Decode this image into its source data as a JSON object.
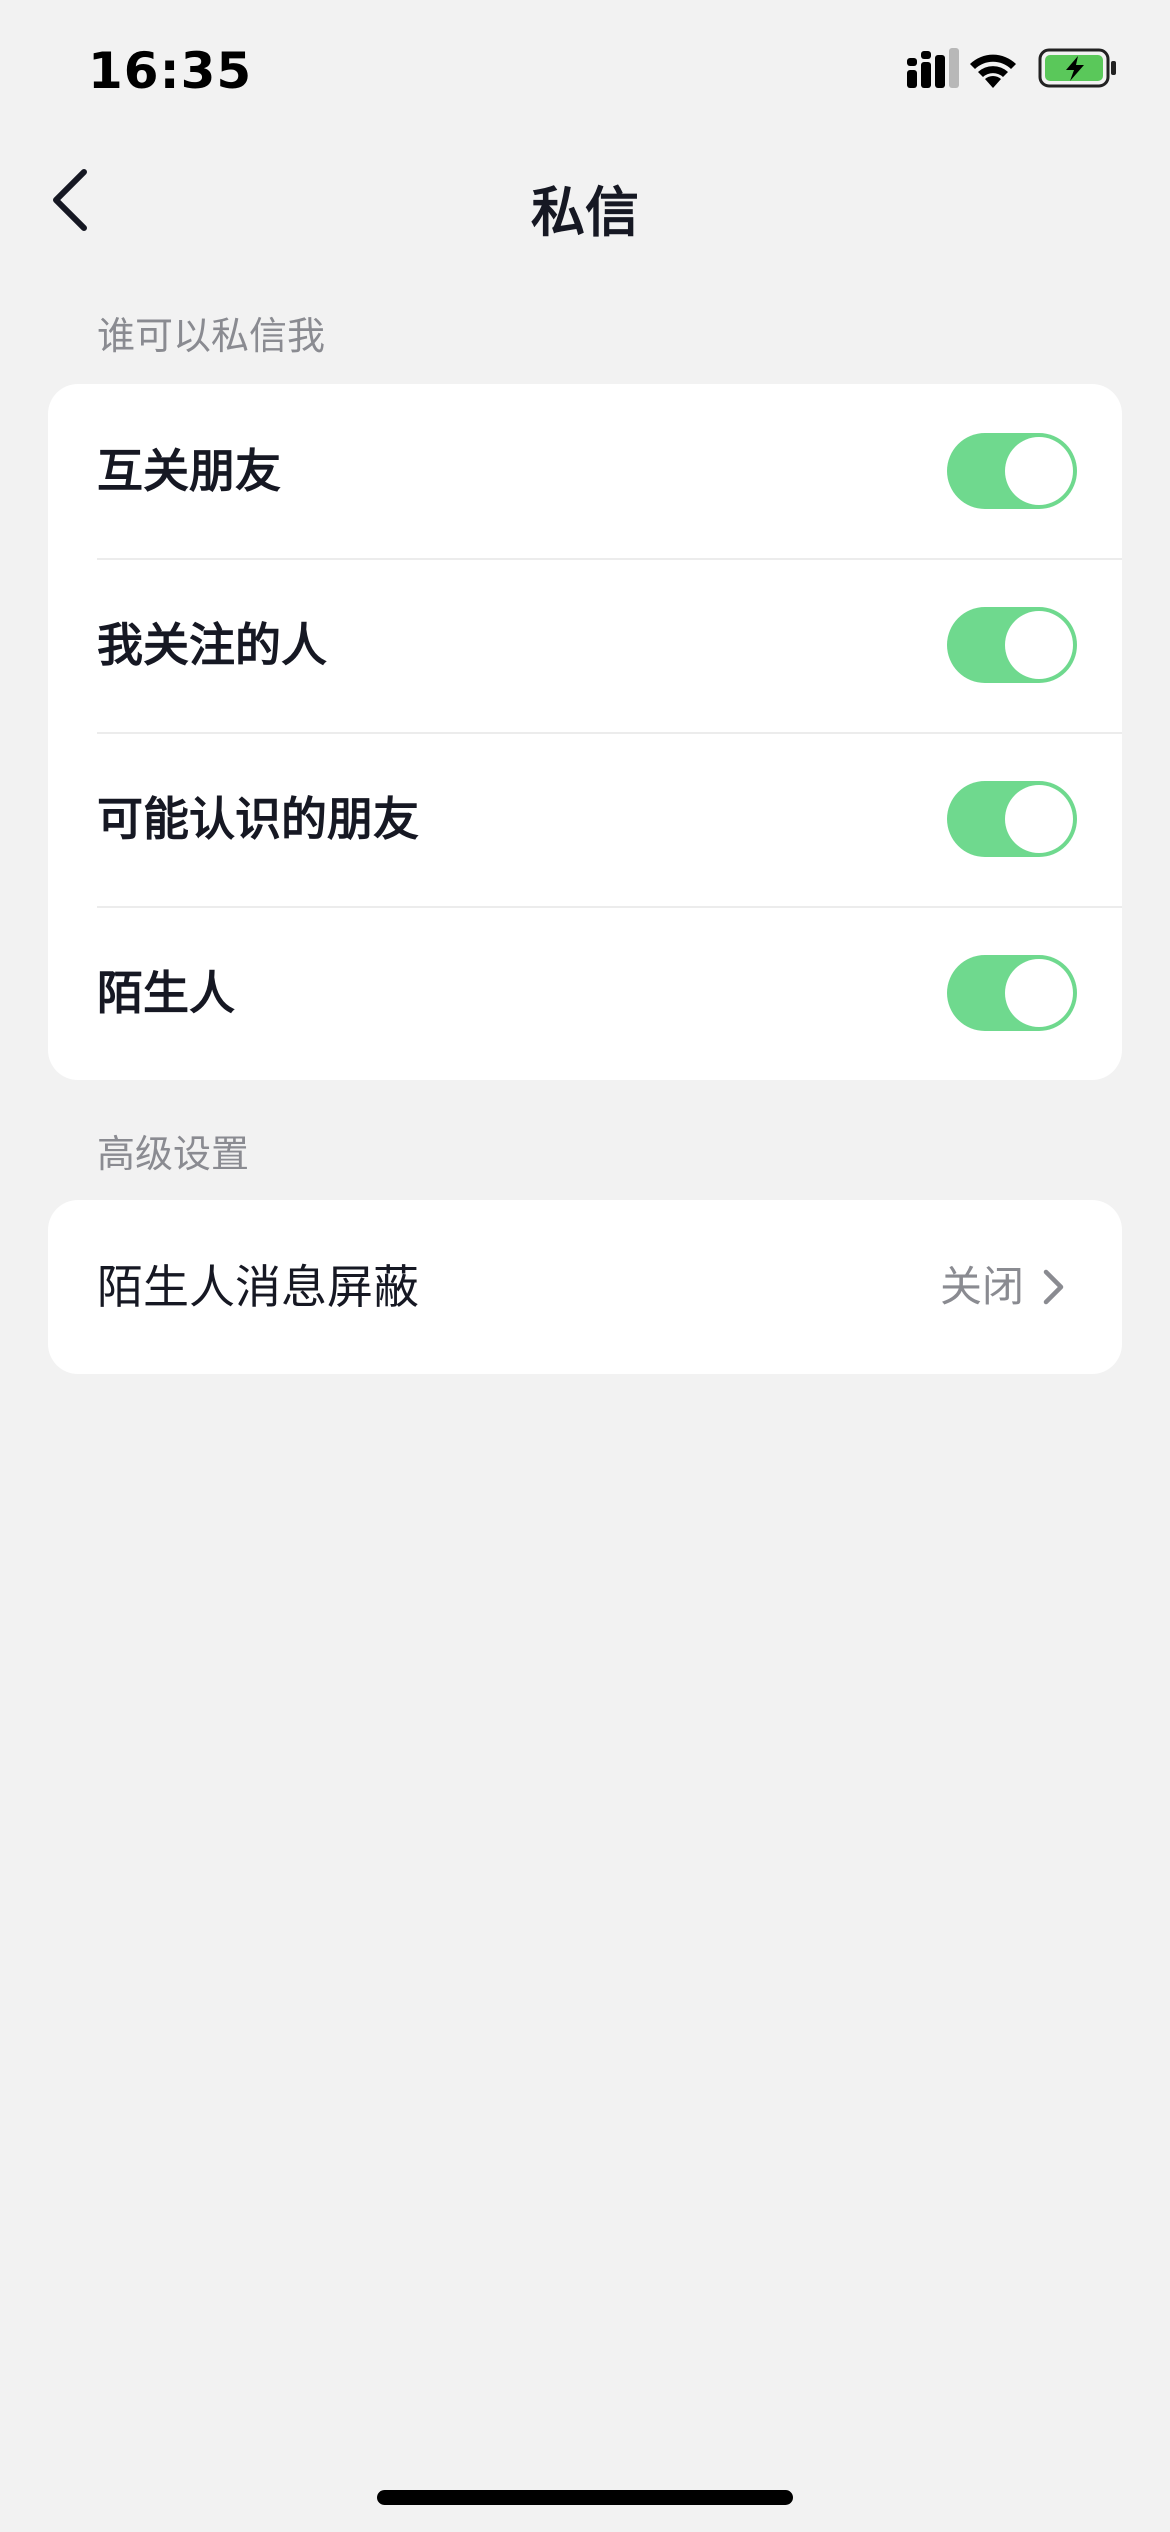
{
  "status_bar": {
    "time": "16:35",
    "icons": [
      "cellular-signal-icon",
      "wifi-icon",
      "battery-charging-icon"
    ],
    "battery_color": "#5ac85a"
  },
  "nav": {
    "title": "私信",
    "back_icon": "chevron-left-icon"
  },
  "sections": {
    "who_can_message": {
      "header": "谁可以私信我",
      "items": [
        {
          "label": "互关朋友",
          "enabled": true
        },
        {
          "label": "我关注的人",
          "enabled": true
        },
        {
          "label": "可能认识的朋友",
          "enabled": true
        },
        {
          "label": "陌生人",
          "enabled": true
        }
      ]
    },
    "advanced": {
      "header": "高级设置",
      "items": [
        {
          "label": "陌生人消息屏蔽",
          "value": "关闭",
          "icon": "chevron-right-icon"
        }
      ]
    }
  },
  "colors": {
    "background": "#f2f2f2",
    "card": "#ffffff",
    "toggle_on": "#6fd98e",
    "secondary_text": "#8a8b91"
  }
}
